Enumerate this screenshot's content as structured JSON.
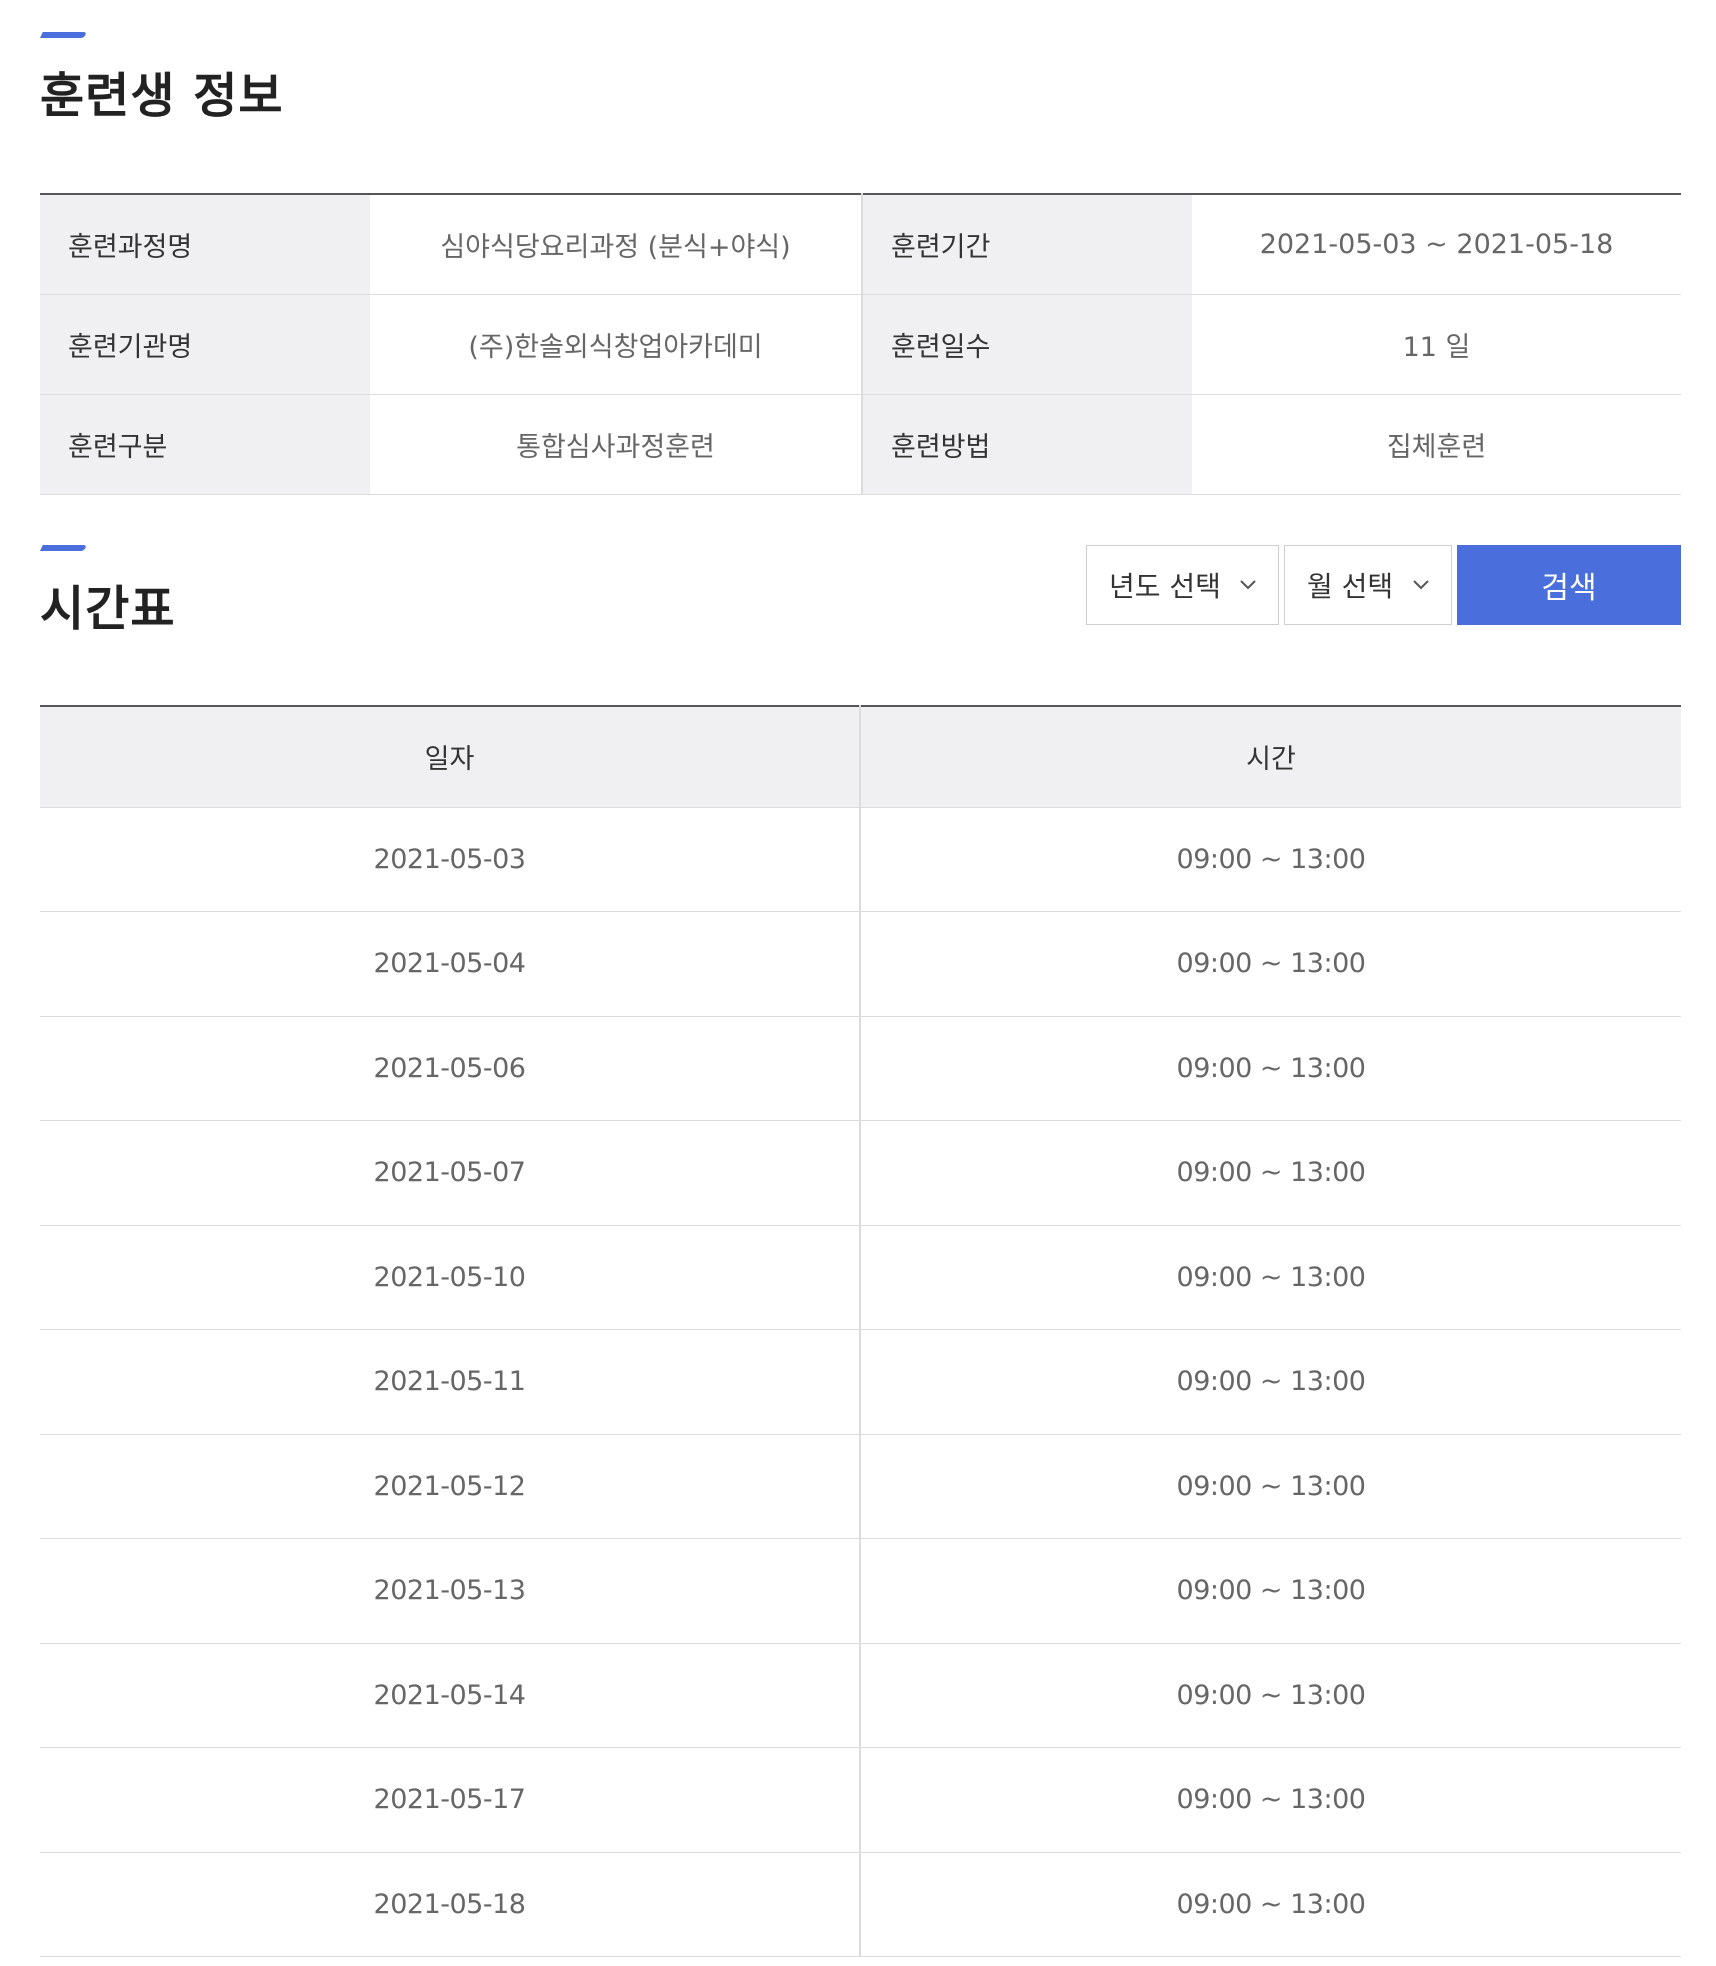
{
  "trainee_section": {
    "title": "훈련생 정보",
    "rows": [
      {
        "label1": "훈련과정명",
        "value1": "심야식당요리과정 (분식+야식)",
        "label2": "훈련기간",
        "value2": "2021-05-03 ~ 2021-05-18"
      },
      {
        "label1": "훈련기관명",
        "value1": "(주)한솔외식창업아카데미",
        "label2": "훈련일수",
        "value2": "11 일"
      },
      {
        "label1": "훈련구분",
        "value1": "통합심사과정훈련",
        "label2": "훈련방법",
        "value2": "집체훈련"
      }
    ]
  },
  "timetable_section": {
    "title": "시간표",
    "year_select": "년도 선택",
    "month_select": "월 선택",
    "search_label": "검색",
    "columns": [
      "일자",
      "시간"
    ],
    "rows": [
      {
        "date": "2021-05-03",
        "time": "09:00 ~ 13:00"
      },
      {
        "date": "2021-05-04",
        "time": "09:00 ~ 13:00"
      },
      {
        "date": "2021-05-06",
        "time": "09:00 ~ 13:00"
      },
      {
        "date": "2021-05-07",
        "time": "09:00 ~ 13:00"
      },
      {
        "date": "2021-05-10",
        "time": "09:00 ~ 13:00"
      },
      {
        "date": "2021-05-11",
        "time": "09:00 ~ 13:00"
      },
      {
        "date": "2021-05-12",
        "time": "09:00 ~ 13:00"
      },
      {
        "date": "2021-05-13",
        "time": "09:00 ~ 13:00"
      },
      {
        "date": "2021-05-14",
        "time": "09:00 ~ 13:00"
      },
      {
        "date": "2021-05-17",
        "time": "09:00 ~ 13:00"
      },
      {
        "date": "2021-05-18",
        "time": "09:00 ~ 13:00"
      }
    ]
  },
  "colors": {
    "accent": "#4a6fdc",
    "label_bg": "#f0f0f2",
    "border": "#dcdcdc"
  },
  "icons": {
    "select_arrow": "chevron-down-icon"
  }
}
